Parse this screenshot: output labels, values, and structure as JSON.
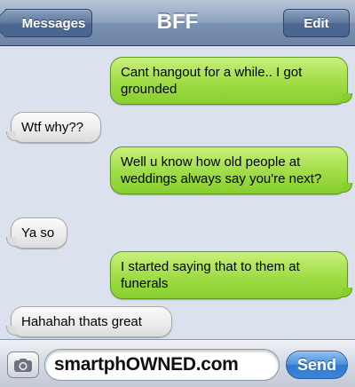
{
  "navbar": {
    "back_label": "Messages",
    "title": "BFF",
    "edit_label": "Edit"
  },
  "messages": [
    {
      "direction": "outgoing",
      "text": "Cant hangout for a while.. I got grounded"
    },
    {
      "direction": "incoming",
      "text": "Wtf why??"
    },
    {
      "direction": "outgoing",
      "text": "Well u know how old people at weddings always say you're next?"
    },
    {
      "direction": "incoming",
      "text": "Ya so"
    },
    {
      "direction": "outgoing",
      "text": "I started saying that to them at funerals"
    },
    {
      "direction": "incoming",
      "text": "Hahahah thats great"
    }
  ],
  "compose": {
    "camera_icon": "camera-icon",
    "input_value": "smartphOWNED.com",
    "send_label": "Send"
  },
  "colors": {
    "outgoing_bubble": "#9fdc45",
    "incoming_bubble": "#eaeaea",
    "background": "#dbe2ed",
    "send_button": "#3b86d8"
  }
}
